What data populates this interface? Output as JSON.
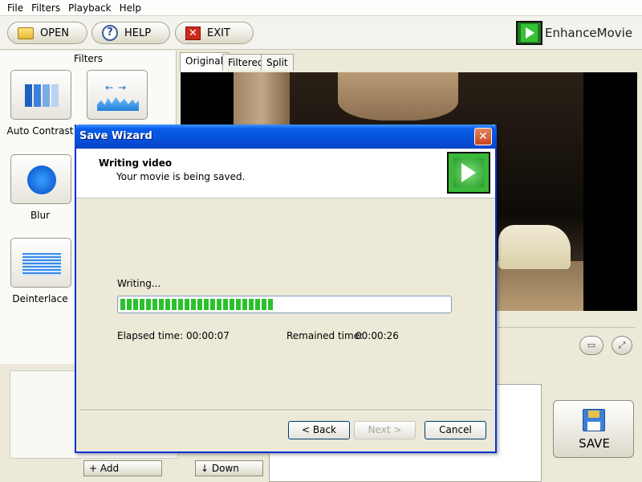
{
  "menubar": {
    "items": [
      "File",
      "Filters",
      "Playback",
      "Help"
    ]
  },
  "toolbar": {
    "open_label": "OPEN",
    "help_label": "HELP",
    "exit_label": "EXIT",
    "help_icon_glyph": "?",
    "exit_icon_glyph": "✕",
    "logo_text": "EnhanceMovie"
  },
  "filters": {
    "title": "Filters",
    "items": [
      {
        "label": "Auto Contrast",
        "icon": "contrast-bars-icon"
      },
      {
        "label": "",
        "icon": "histogram-icon"
      },
      {
        "label": "Blur",
        "icon": "blur-circle-icon"
      },
      {
        "label": "Deinterlace",
        "icon": "deinterlace-stripes-icon"
      }
    ]
  },
  "preview": {
    "tabs": [
      "Original",
      "Filtered",
      "Split"
    ],
    "active_tab": "Original"
  },
  "bottom": {
    "add_label": "+ Add",
    "down_label": "↓ Down",
    "save_label": "SAVE"
  },
  "dialog": {
    "title": "Save Wizard",
    "close_glyph": "✕",
    "heading": "Writing video",
    "subheading": "Your movie is being saved.",
    "status_label": "Writing...",
    "progress_fraction": 0.47,
    "elapsed_label": "Elapsed time:",
    "elapsed_value": "00:00:07",
    "remained_label": "Remained time:",
    "remained_value": "00:00:26",
    "back_label": "< Back",
    "next_label": "Next >",
    "cancel_label": "Cancel"
  },
  "colors": {
    "titlebar_blue": "#0a5ce9",
    "progress_green": "#2cc12c",
    "window_bg": "#ece9d8"
  }
}
